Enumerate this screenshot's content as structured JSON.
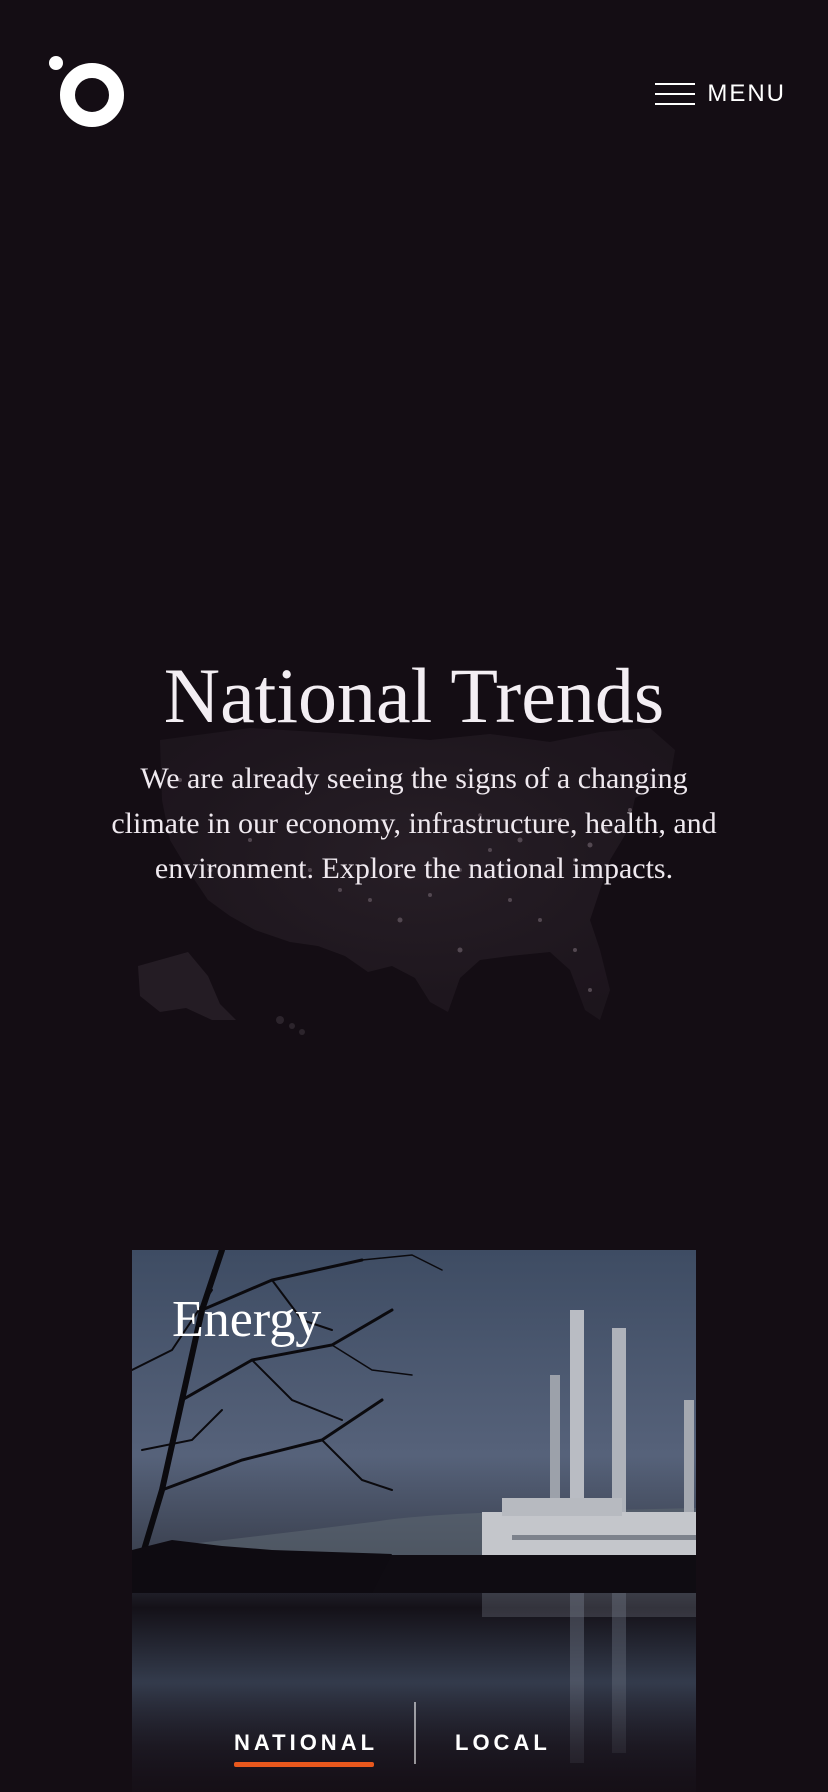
{
  "header": {
    "logo_icon": "ring-with-dot-logo",
    "menu_icon": "hamburger-icon",
    "menu_label": "MENU"
  },
  "hero": {
    "title": "National Trends",
    "description": "We are already seeing the signs of a changing climate in our economy, infrastructure, health, and environment. Explore the national impacts.",
    "background_icon": "us-map-night-lights"
  },
  "card": {
    "title": "Energy",
    "image": "power-plant-smokestacks-reflected-in-water"
  },
  "tabs": {
    "items": [
      {
        "label": "NATIONAL",
        "active": true
      },
      {
        "label": "LOCAL",
        "active": false
      }
    ],
    "accent_color": "#e8581d"
  },
  "colors": {
    "background": "#140d14",
    "text": "#f3eef3"
  }
}
